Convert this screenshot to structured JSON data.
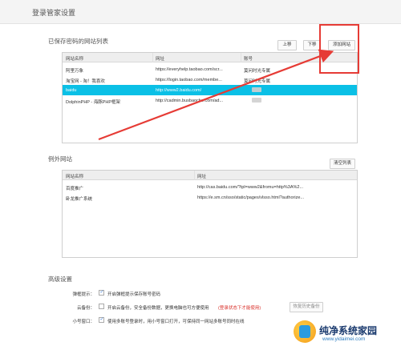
{
  "page": {
    "title": "登录管家设置"
  },
  "saved_sites": {
    "section_title": "已保存密码的网站列表",
    "buttons": {
      "up": "上移",
      "down": "下移",
      "add": "添加网站"
    },
    "columns": [
      "网站名称",
      "网址",
      "账号"
    ],
    "rows": [
      {
        "name": "阿里万象",
        "url": "https://everyhelp.taobao.com/scr...",
        "account": "莫问时光专属",
        "selected": false
      },
      {
        "name": "淘宝网 - 淘！我喜欢",
        "url": "https://login.taobao.com/membe...",
        "account": "莫问时光专属",
        "selected": false
      },
      {
        "name": "baidu",
        "url": "http://www2.baidu.com/",
        "account": "",
        "selected": true
      },
      {
        "name": "DolphinPHP - 海豚PHP框架",
        "url": "http://cadmin.busbaoche.com/ad...",
        "account": "",
        "selected": false
      }
    ]
  },
  "exceptions": {
    "section_title": "例外网站",
    "clear_button": "清空列表",
    "columns": [
      "网站名称",
      "网址"
    ],
    "rows": [
      {
        "name": "百度推广",
        "url": "http://cas.baidu.com/?tpl=www2&fromu=http%3A%2..."
      },
      {
        "name": "卧龙推广系统",
        "url": "https://e.sm.cn/sso/static/pages/vlsso.html?authorize..."
      }
    ]
  },
  "advanced": {
    "section_title": "高级设置",
    "rows": [
      {
        "label": "弹框提示：",
        "checked": true,
        "text": "开启弹框提示保存账号密码",
        "note": "",
        "extra_button": ""
      },
      {
        "label": "云备份：",
        "checked": false,
        "text": "开启云备份，安全备份数据，更换电脑也可方便使用",
        "note": "(登录状态下才能使用)",
        "extra_button": "恢复历史备份"
      },
      {
        "label": "小号窗口：",
        "checked": true,
        "text": "使用多账号登录时，用小号窗口打开，可保持同一网站多账号同时在线",
        "note": "",
        "extra_button": ""
      }
    ]
  },
  "watermark": {
    "title": "纯净系统家园",
    "url": "www.yidaimei.com"
  },
  "colors": {
    "selected_row": "#0bc0e6",
    "annotation": "#e63b35",
    "warning": "#d9302a"
  }
}
